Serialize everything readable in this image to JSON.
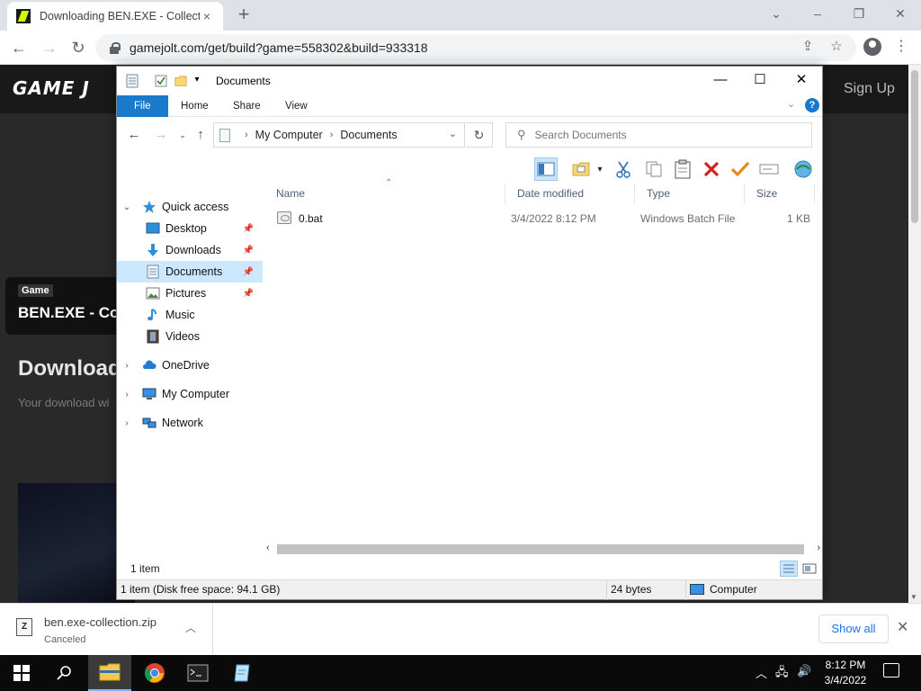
{
  "browser": {
    "tab_title": "Downloading BEN.EXE - Collectio",
    "url": "gamejolt.com/get/build?game=558302&build=933318",
    "tab_close": "×",
    "new_tab": "+"
  },
  "page": {
    "logo": "GAME J",
    "signup": "Sign Up",
    "game_badge": "Game",
    "game_name": "BEN.EXE - Co",
    "heading": "Download",
    "subtext": "Your download wi"
  },
  "explorer": {
    "title": "Documents",
    "ribbon_tabs": [
      "File",
      "Home",
      "Share",
      "View"
    ],
    "help": "?",
    "address": {
      "root": "My Computer",
      "current": "Documents"
    },
    "search_placeholder": "Search Documents",
    "nav": {
      "quick_access": "Quick access",
      "desktop": "Desktop",
      "downloads": "Downloads",
      "documents": "Documents",
      "pictures": "Pictures",
      "music": "Music",
      "videos": "Videos",
      "onedrive": "OneDrive",
      "my_computer": "My Computer",
      "network": "Network"
    },
    "columns": {
      "name": "Name",
      "date": "Date modified",
      "type": "Type",
      "size": "Size"
    },
    "files": [
      {
        "name": "0.bat",
        "date": "3/4/2022 8:12 PM",
        "type": "Windows Batch File",
        "size": "1 KB"
      }
    ],
    "item_count": "1 item",
    "detail_left": "1 item (Disk free space: 94.1 GB)",
    "detail_bytes": "24 bytes",
    "detail_location": "Computer"
  },
  "downloads": {
    "file": "ben.exe-collection.zip",
    "status": "Canceled",
    "show_all": "Show all"
  },
  "taskbar": {
    "time": "8:12 PM",
    "date": "3/4/2022"
  },
  "colors": {
    "accent": "#1979ca",
    "selection": "#cce8ff",
    "delete_red": "#d42020",
    "check_orange": "#e8891c"
  }
}
